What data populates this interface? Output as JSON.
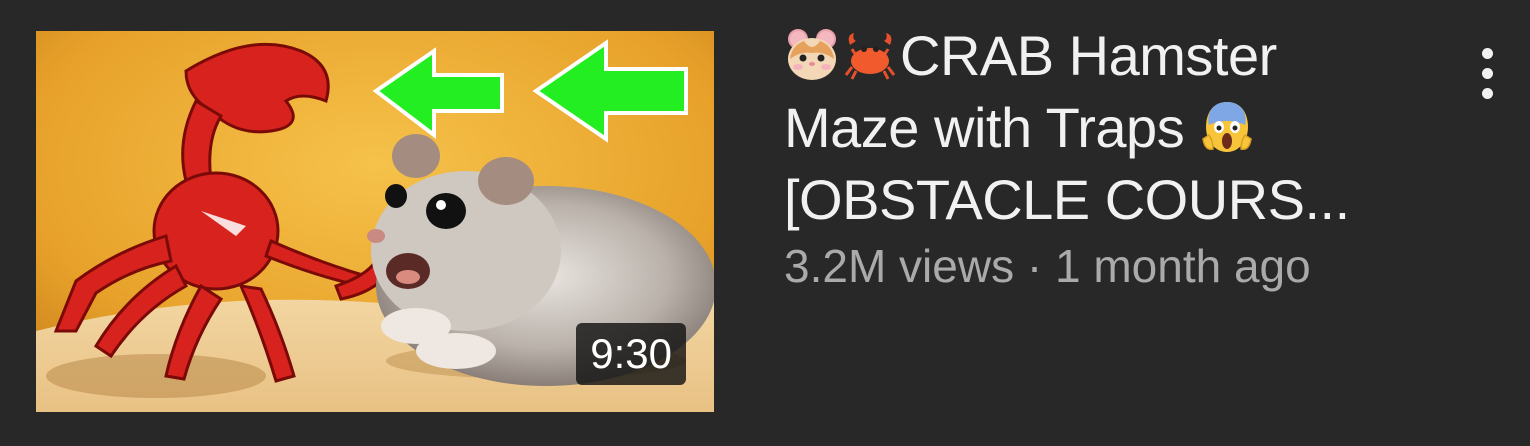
{
  "video": {
    "title_emojis": [
      "hamster-emoji",
      "crab-emoji"
    ],
    "title_line1": "CRAB Hamster",
    "title_line2": "Maze with Traps",
    "title_line2_emoji": "scream-emoji",
    "title_line3": "[OBSTACLE COURS...",
    "views": "3.2M views",
    "separator": "·",
    "age": "1 month ago",
    "duration": "9:30"
  },
  "menu": {
    "icon": "more-vert-icon"
  },
  "colors": {
    "background": "#282828",
    "title": "#f1f1f1",
    "meta": "#aaaaaa",
    "arrow": "#22ee22"
  }
}
